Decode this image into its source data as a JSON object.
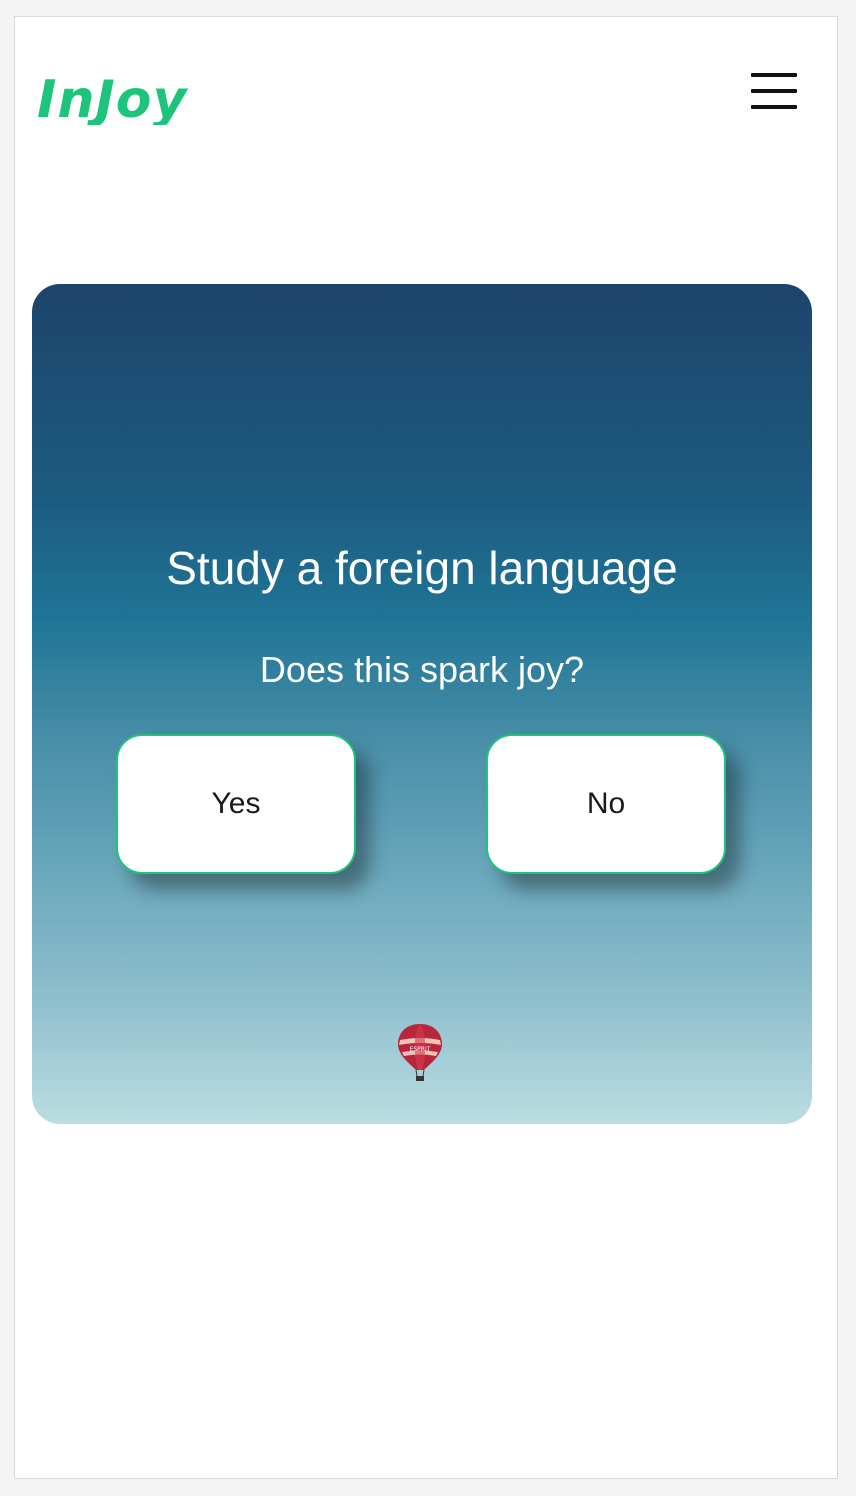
{
  "header": {
    "logo_text": "InJoy",
    "menu_icon": "hamburger-menu-icon"
  },
  "card": {
    "title": "Study a foreign language",
    "question": "Does this spark joy?",
    "yes_label": "Yes",
    "no_label": "No",
    "background_image": "hot-air-balloon-sky",
    "balloon_text": "ESPRIT"
  },
  "colors": {
    "brand_green": "#1ec47c",
    "sky_top": "#1d446b",
    "sky_bottom": "#bbdde1"
  }
}
